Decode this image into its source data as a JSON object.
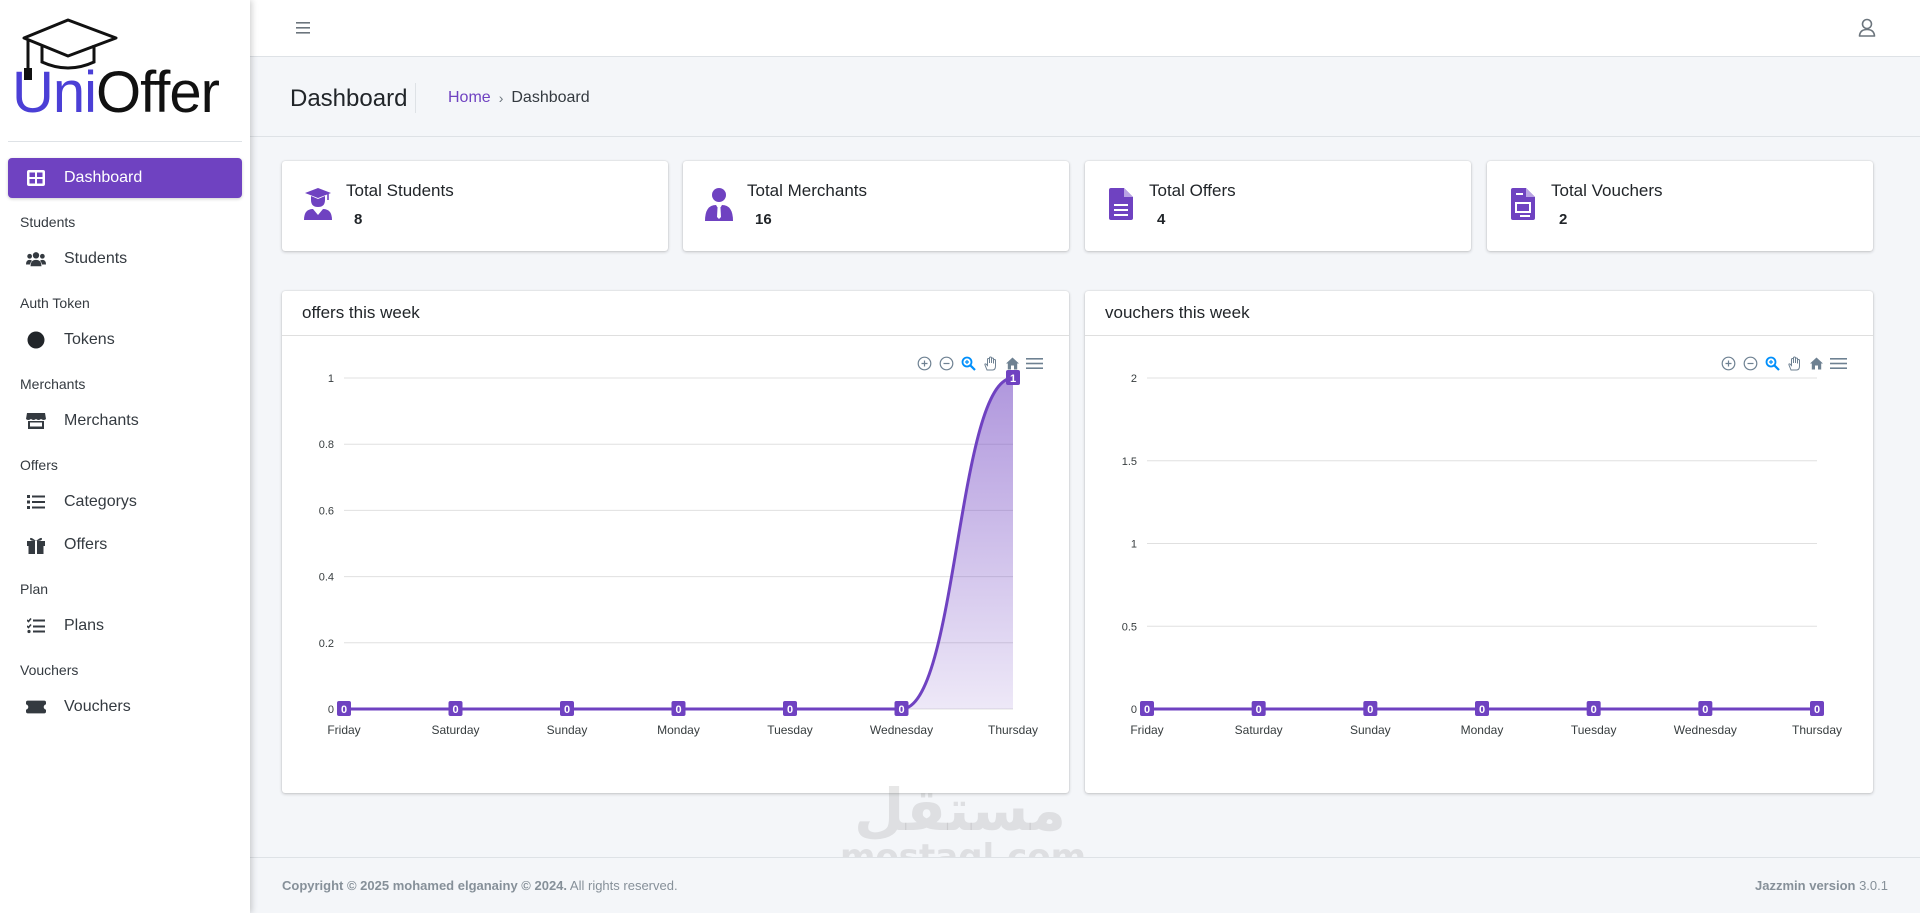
{
  "brand": {
    "logo_uni": "Uni",
    "logo_offer": "Offer"
  },
  "sidebar": {
    "items": [
      {
        "type": "item",
        "label": "Dashboard",
        "icon": "dashboard-icon",
        "active": true
      },
      {
        "type": "header",
        "label": "Students"
      },
      {
        "type": "item",
        "label": "Students",
        "icon": "users-icon"
      },
      {
        "type": "header",
        "label": "Auth Token"
      },
      {
        "type": "item",
        "label": "Tokens",
        "icon": "circle-icon"
      },
      {
        "type": "header",
        "label": "Merchants"
      },
      {
        "type": "item",
        "label": "Merchants",
        "icon": "store-icon"
      },
      {
        "type": "header",
        "label": "Offers"
      },
      {
        "type": "item",
        "label": "Categorys",
        "icon": "list-icon"
      },
      {
        "type": "item",
        "label": "Offers",
        "icon": "gift-icon"
      },
      {
        "type": "header",
        "label": "Plan"
      },
      {
        "type": "item",
        "label": "Plans",
        "icon": "tasks-icon"
      },
      {
        "type": "header",
        "label": "Vouchers"
      },
      {
        "type": "item",
        "label": "Vouchers",
        "icon": "ticket-icon"
      }
    ]
  },
  "header": {
    "title": "Dashboard",
    "breadcrumb_home": "Home",
    "breadcrumb_sep": "›",
    "breadcrumb_current": "Dashboard"
  },
  "stats": [
    {
      "label": "Total Students",
      "value": "8",
      "icon": "graduate-icon"
    },
    {
      "label": "Total Merchants",
      "value": "16",
      "icon": "user-tie-icon"
    },
    {
      "label": "Total Offers",
      "value": "4",
      "icon": "file-icon"
    },
    {
      "label": "Total Vouchers",
      "value": "2",
      "icon": "voucher-file-icon"
    }
  ],
  "colors": {
    "accent": "#6f42c1",
    "brand_uni": "#4b3fd6"
  },
  "chart_data": [
    {
      "type": "area",
      "title": "offers this week",
      "categories": [
        "Friday",
        "Saturday",
        "Sunday",
        "Monday",
        "Tuesday",
        "Wednesday",
        "Thursday"
      ],
      "values": [
        0,
        0,
        0,
        0,
        0,
        0,
        1
      ],
      "ylim": [
        0,
        1
      ],
      "yticks": [
        "0",
        "0.2",
        "0.4",
        "0.6",
        "0.8",
        "1"
      ],
      "grid": true
    },
    {
      "type": "line",
      "title": "vouchers this week",
      "categories": [
        "Friday",
        "Saturday",
        "Sunday",
        "Monday",
        "Tuesday",
        "Wednesday",
        "Thursday"
      ],
      "values": [
        0,
        0,
        0,
        0,
        0,
        0,
        0
      ],
      "ylim": [
        0,
        2
      ],
      "yticks": [
        "0",
        "0.5",
        "1",
        "1.5",
        "2"
      ],
      "grid": true
    }
  ],
  "footer": {
    "copyright_bold": "Copyright © 2025 mohamed elganainy © 2024.",
    "copyright_rest": " All rights reserved.",
    "version_label": "Jazzmin version",
    "version": " 3.0.1"
  },
  "watermark": {
    "arabic": "مستقل",
    "latin": "mostaql.com"
  }
}
